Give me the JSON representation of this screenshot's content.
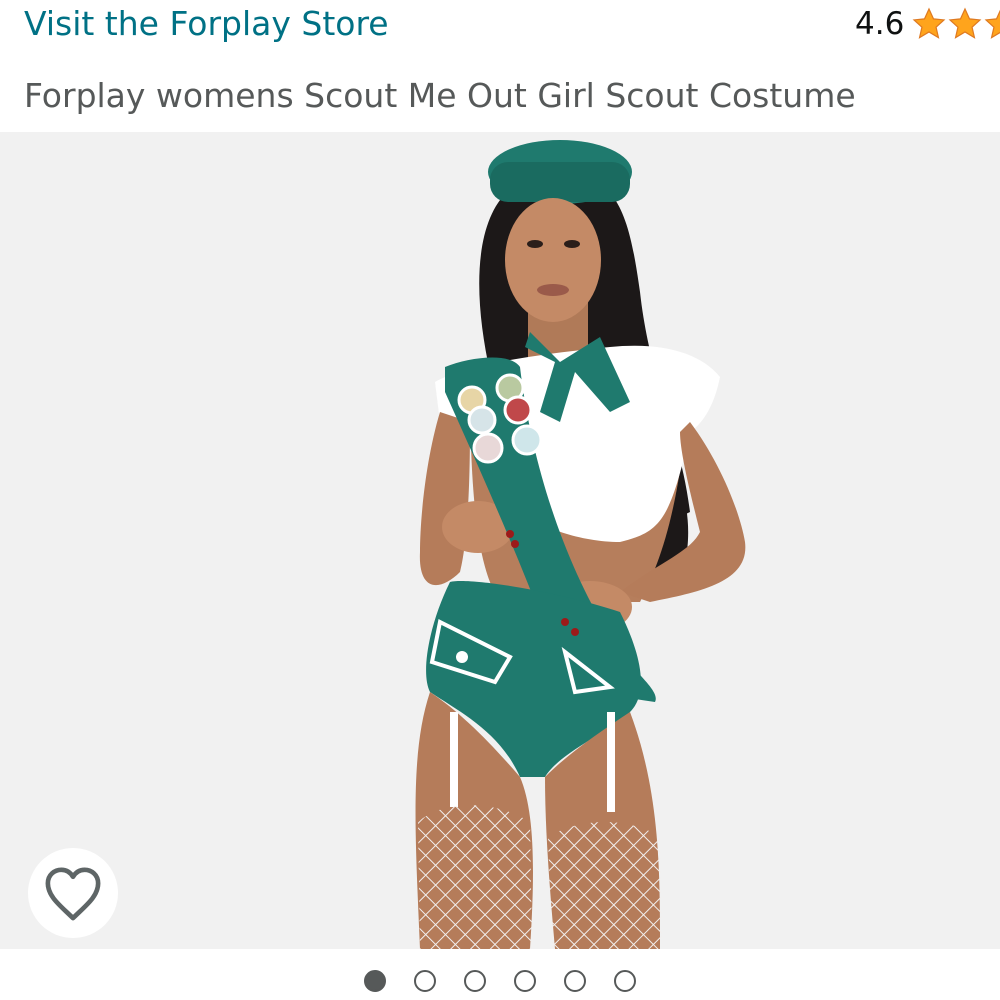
{
  "header": {
    "store_link": "Visit the Forplay Store",
    "rating": {
      "value": "4.6",
      "stars": 4.6
    }
  },
  "product": {
    "title": "Forplay womens Scout Me Out Girl Scout Costume"
  },
  "gallery": {
    "image_count": 6,
    "active_index": 0,
    "wishlist_icon": "heart-icon"
  },
  "colors": {
    "link": "#007185",
    "star": "#ffa41c",
    "title": "#565959",
    "costume_teal": "#1f7a6e",
    "gallery_bg": "#f1f1f1"
  }
}
